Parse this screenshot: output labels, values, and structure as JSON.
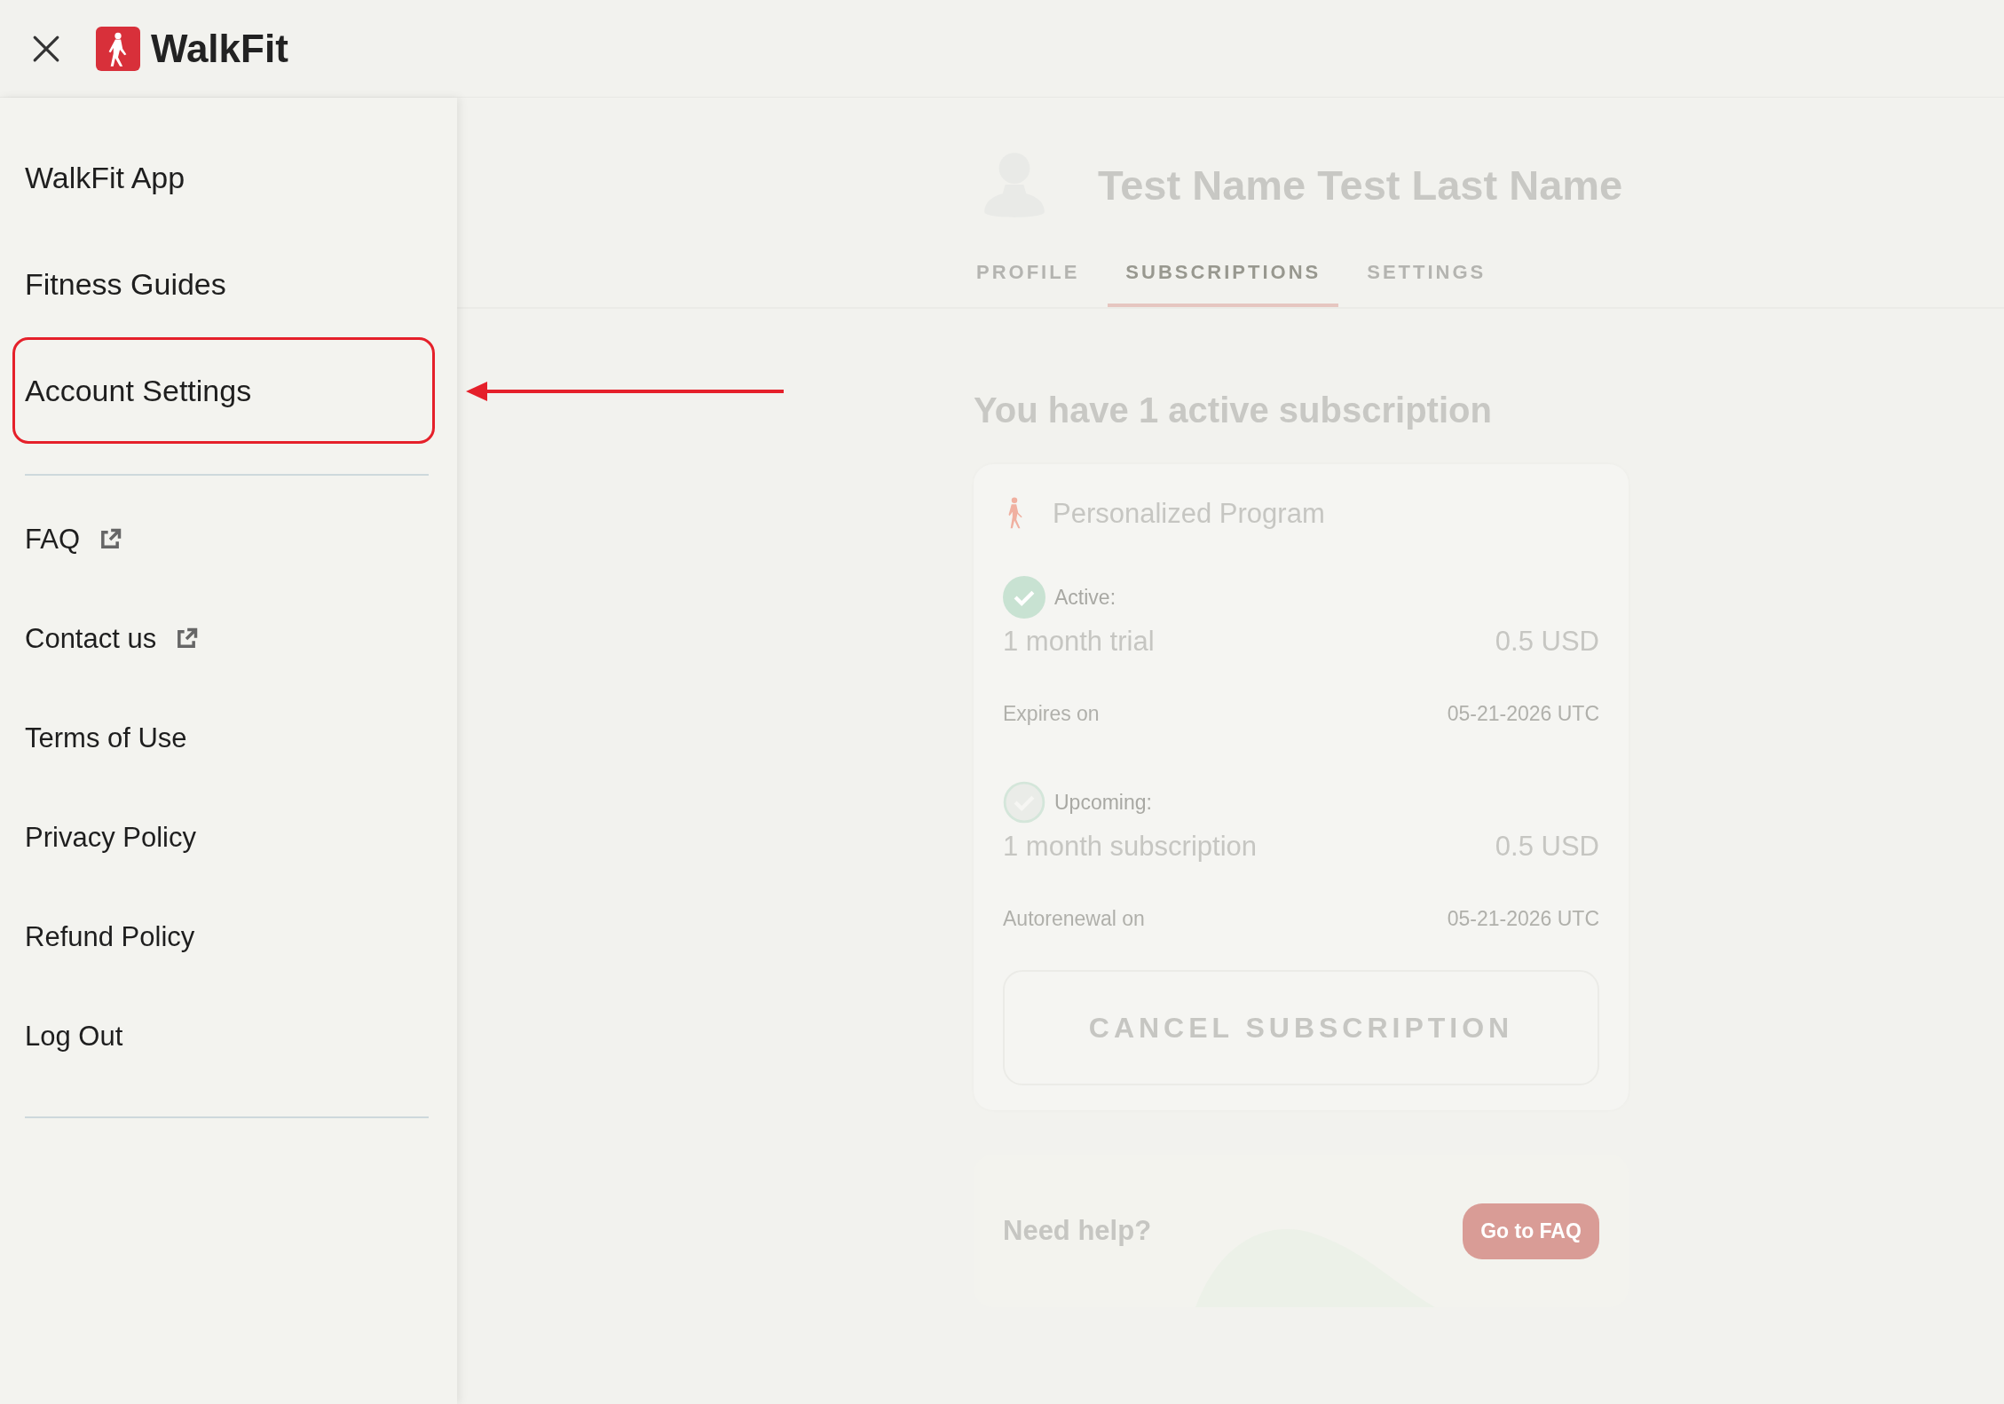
{
  "header": {
    "logo_text": "WalkFit"
  },
  "sidebar": {
    "primary_items": [
      {
        "label": "WalkFit App",
        "highlighted": false
      },
      {
        "label": "Fitness Guides",
        "highlighted": false
      },
      {
        "label": "Account Settings",
        "highlighted": true
      }
    ],
    "secondary_items": [
      {
        "label": "FAQ",
        "external": true
      },
      {
        "label": "Contact us",
        "external": true
      },
      {
        "label": "Terms of Use",
        "external": false
      },
      {
        "label": "Privacy Policy",
        "external": false
      },
      {
        "label": "Refund Policy",
        "external": false
      },
      {
        "label": "Log Out",
        "external": false
      }
    ]
  },
  "profile": {
    "name": "Test Name Test Last Name",
    "tabs": [
      {
        "label": "PROFILE",
        "selected": false
      },
      {
        "label": "SUBSCRIPTIONS",
        "selected": true
      },
      {
        "label": "SETTINGS",
        "selected": false
      }
    ]
  },
  "subscriptions": {
    "heading": "You have 1 active subscription",
    "card": {
      "title": "Personalized Program",
      "entries": [
        {
          "current": true,
          "status_label": "Active:",
          "plan": "1 month trial",
          "price": "0.5 USD",
          "date_label": "Expires on",
          "date": "05-21-2026 UTC"
        },
        {
          "current": false,
          "status_label": "Upcoming:",
          "plan": "1 month subscription",
          "price": "0.5 USD",
          "date_label": "Autorenewal on",
          "date": "05-21-2026 UTC"
        }
      ],
      "cancel_button": "CANCEL SUBSCRIPTION"
    },
    "help": {
      "text": "Need help?",
      "button": "Go to FAQ"
    }
  }
}
